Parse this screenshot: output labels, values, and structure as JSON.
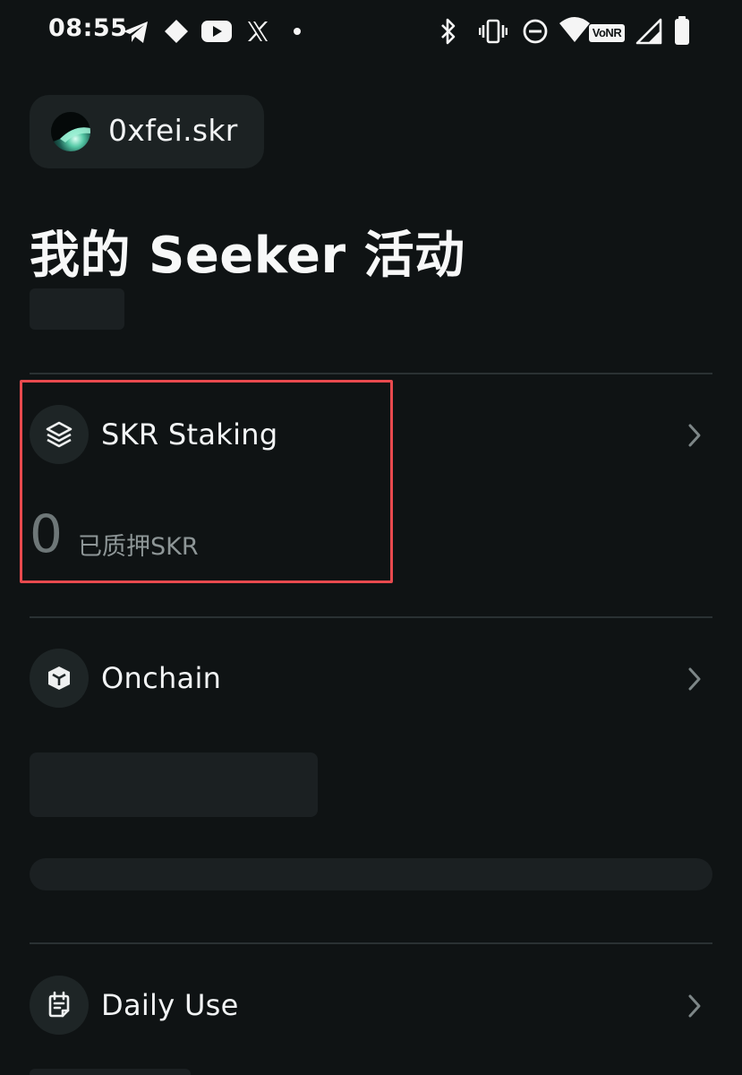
{
  "status_bar": {
    "time": "08:55",
    "notification_icons": [
      "telegram-icon",
      "diamond-icon",
      "youtube-icon",
      "x-icon",
      "dot-icon"
    ],
    "system_icons": [
      "bluetooth-icon",
      "vibrate-icon",
      "do-not-disturb-icon",
      "wifi-icon",
      "signal-icon",
      "battery-icon"
    ],
    "network_badge": "VoNR"
  },
  "account": {
    "name": "0xfei.skr"
  },
  "page": {
    "title": "我的 Seeker 活动"
  },
  "sections": [
    {
      "id": "skr-staking",
      "label": "SKR Staking",
      "icon": "layers-icon",
      "stat_value": "0",
      "stat_label": "已质押SKR",
      "highlighted": true
    },
    {
      "id": "onchain",
      "label": "Onchain",
      "icon": "cube-icon"
    },
    {
      "id": "daily-use",
      "label": "Daily Use",
      "icon": "calendar-icon"
    }
  ],
  "colors": {
    "background": "#0f1314",
    "surface": "#1c2223",
    "divider": "#2a3133",
    "highlight": "#e84a4e",
    "muted_text": "#8e9697"
  }
}
